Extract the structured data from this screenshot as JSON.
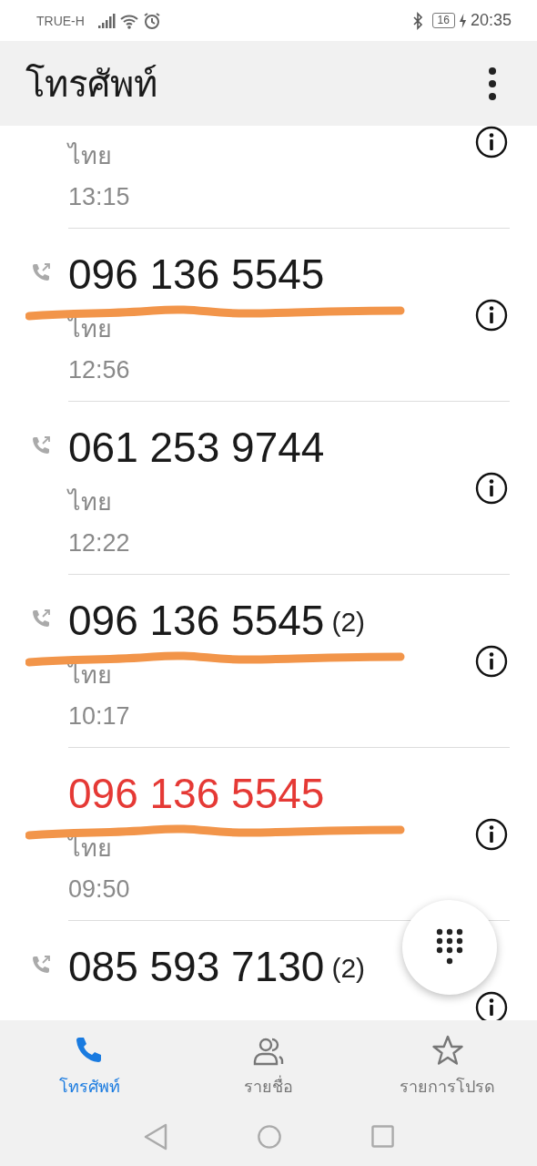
{
  "status_bar": {
    "carrier": "TRUE-H",
    "battery": "16",
    "time": "20:35"
  },
  "app_bar": {
    "title": "โทรศัพท์"
  },
  "calls": [
    {
      "location": "ไทย",
      "time": "13:15"
    },
    {
      "number": "096 136 5545",
      "kind": "outgoing",
      "location": "ไทย",
      "time": "12:56",
      "annotated": true
    },
    {
      "number": "061 253 9744",
      "kind": "outgoing",
      "location": "ไทย",
      "time": "12:22",
      "annotated": false
    },
    {
      "number": "096 136 5545",
      "count": "(2)",
      "kind": "outgoing",
      "location": "ไทย",
      "time": "10:17",
      "annotated": true
    },
    {
      "number": "096 136 5545",
      "kind": "missed",
      "location": "ไทย",
      "time": "09:50",
      "annotated": true
    },
    {
      "number": "085 593 7130",
      "count": "(2)",
      "kind": "outgoing",
      "annotated": false
    }
  ],
  "tabs": [
    {
      "label": "โทรศัพท์",
      "kind": "phone",
      "selected": true
    },
    {
      "label": "รายชื่อ",
      "kind": "contacts",
      "selected": false
    },
    {
      "label": "รายการโปรด",
      "kind": "star",
      "selected": false
    }
  ]
}
